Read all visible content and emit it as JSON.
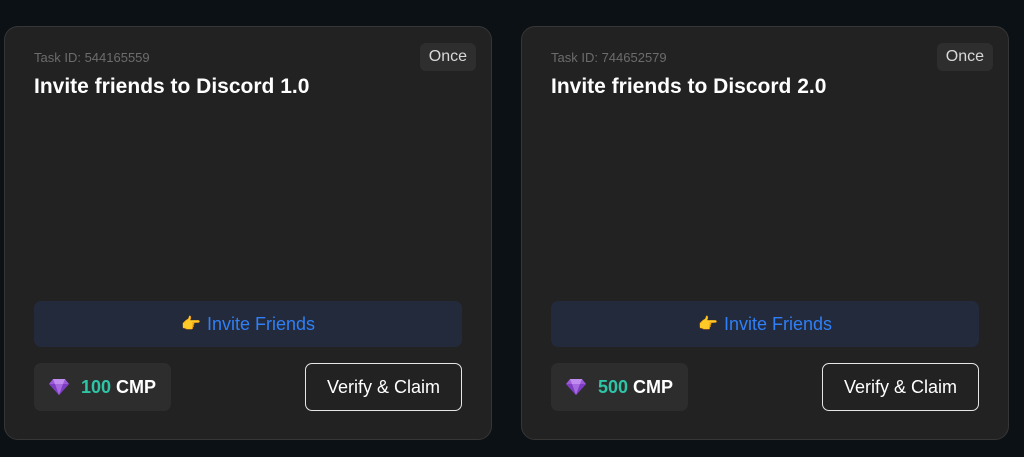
{
  "tasks": [
    {
      "task_id": "Task ID: 544165559",
      "frequency": "Once",
      "title": "Invite friends to Discord 1.0",
      "invite_emoji": "👉",
      "invite_label": "Invite Friends",
      "reward_amount": "100",
      "reward_unit": "CMP",
      "reward_icon": "gem-icon",
      "verify_label": "Verify & Claim"
    },
    {
      "task_id": "Task ID: 744652579",
      "frequency": "Once",
      "title": "Invite friends to Discord 2.0",
      "invite_emoji": "👉",
      "invite_label": "Invite Friends",
      "reward_amount": "500",
      "reward_unit": "CMP",
      "reward_icon": "gem-icon",
      "verify_label": "Verify & Claim"
    }
  ],
  "colors": {
    "background": "#0c1115",
    "card": "#222222",
    "invite_text": "#2f7ff6",
    "reward_amount": "#2ec4a6"
  }
}
